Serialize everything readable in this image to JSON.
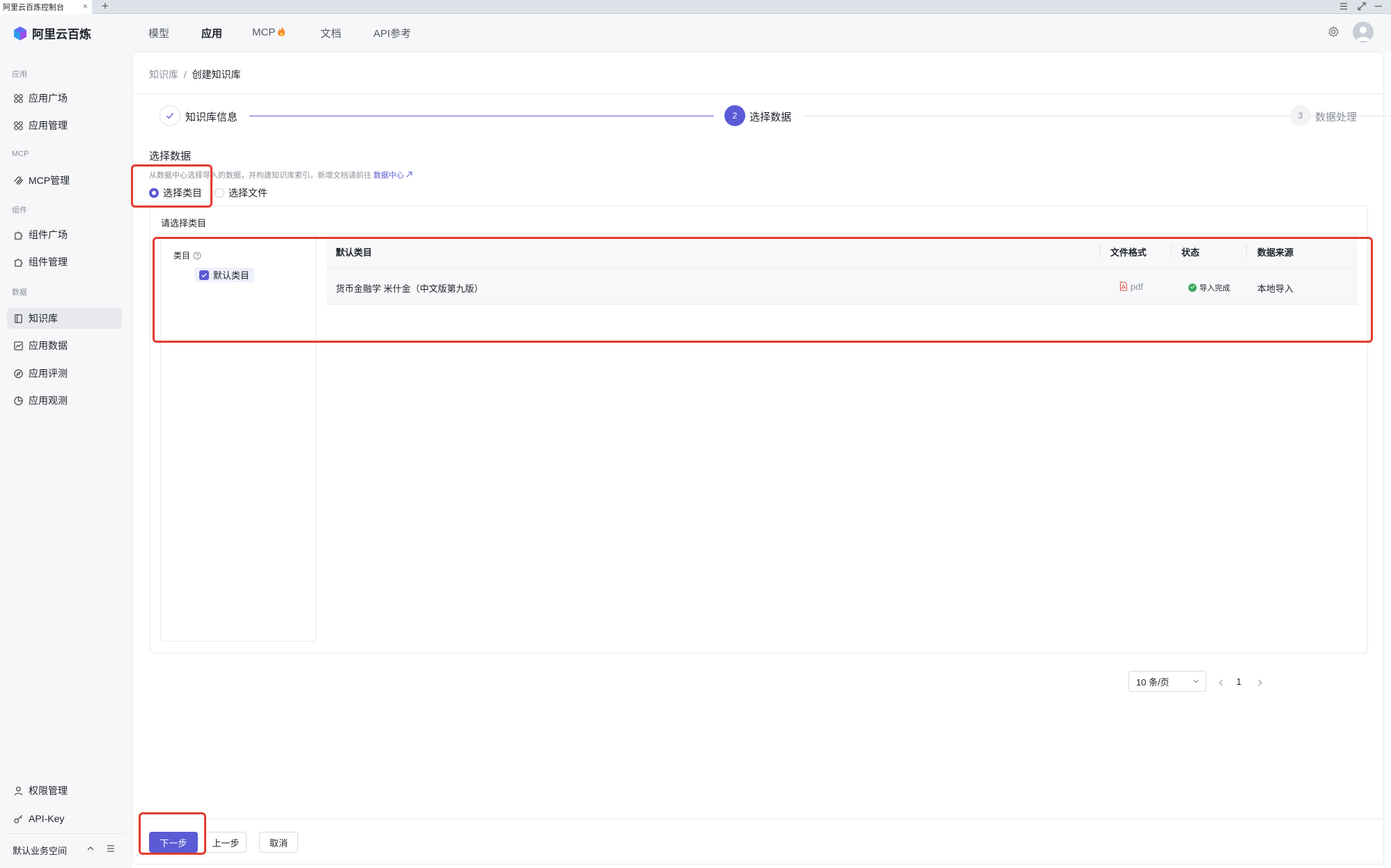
{
  "browser": {
    "tab_title": "阿里云百炼控制台",
    "close_glyph": "×",
    "new_tab_glyph": "+"
  },
  "topnav": {
    "logo_text": "阿里云百炼",
    "items": [
      {
        "label": "模型"
      },
      {
        "label": "应用"
      },
      {
        "label": "MCP"
      },
      {
        "label": "文档"
      },
      {
        "label": "API参考"
      }
    ],
    "active": "应用"
  },
  "sidebar": {
    "groups": {
      "app": "应用",
      "mcp": "MCP",
      "component": "组件",
      "data": "数据"
    },
    "items": {
      "app_plaza": "应用广场",
      "app_manage": "应用管理",
      "mcp_manage": "MCP管理",
      "comp_plaza": "组件广场",
      "comp_manage": "组件管理",
      "knowledge": "知识库",
      "app_data": "应用数据",
      "app_eval": "应用评测",
      "app_observe": "应用观测",
      "permission": "权限管理",
      "api_key": "API-Key"
    },
    "workspace": "默认业务空间"
  },
  "breadcrumb": {
    "parent": "知识库",
    "separator": "/",
    "current": "创建知识库"
  },
  "steps": [
    {
      "label": "知识库信息",
      "status": "done"
    },
    {
      "number": "2",
      "label": "选择数据",
      "status": "current"
    },
    {
      "number": "3",
      "label": "数据处理",
      "status": "pending"
    }
  ],
  "section": {
    "title": "选择数据",
    "desc": "从数据中心选择导入的数据，并构建知识库索引。新增文档请前往",
    "desc_link": "数据中心",
    "options": {
      "category": "选择类目",
      "file": "选择文件"
    },
    "selected": "选择类目"
  },
  "panel": {
    "title": "请选择类目",
    "tree_header": "类目",
    "tree_node": "默认类目"
  },
  "table": {
    "headers": {
      "name": "默认类目",
      "format": "文件格式",
      "status": "状态",
      "source": "数据来源"
    },
    "rows": [
      {
        "name": "货币金融学 米什金（中文版第九版）",
        "format": "pdf",
        "status": "导入完成",
        "source": "本地导入"
      }
    ]
  },
  "pagination": {
    "page": "1",
    "page_size": "10 条/页",
    "prev": "‹",
    "next": "›"
  },
  "footer": {
    "next": "下一步",
    "prev": "上一步",
    "cancel": "取消"
  },
  "colors": {
    "accent": "#5b5bd6",
    "highlight": "#e23b2e",
    "success": "#3aaa5c"
  }
}
